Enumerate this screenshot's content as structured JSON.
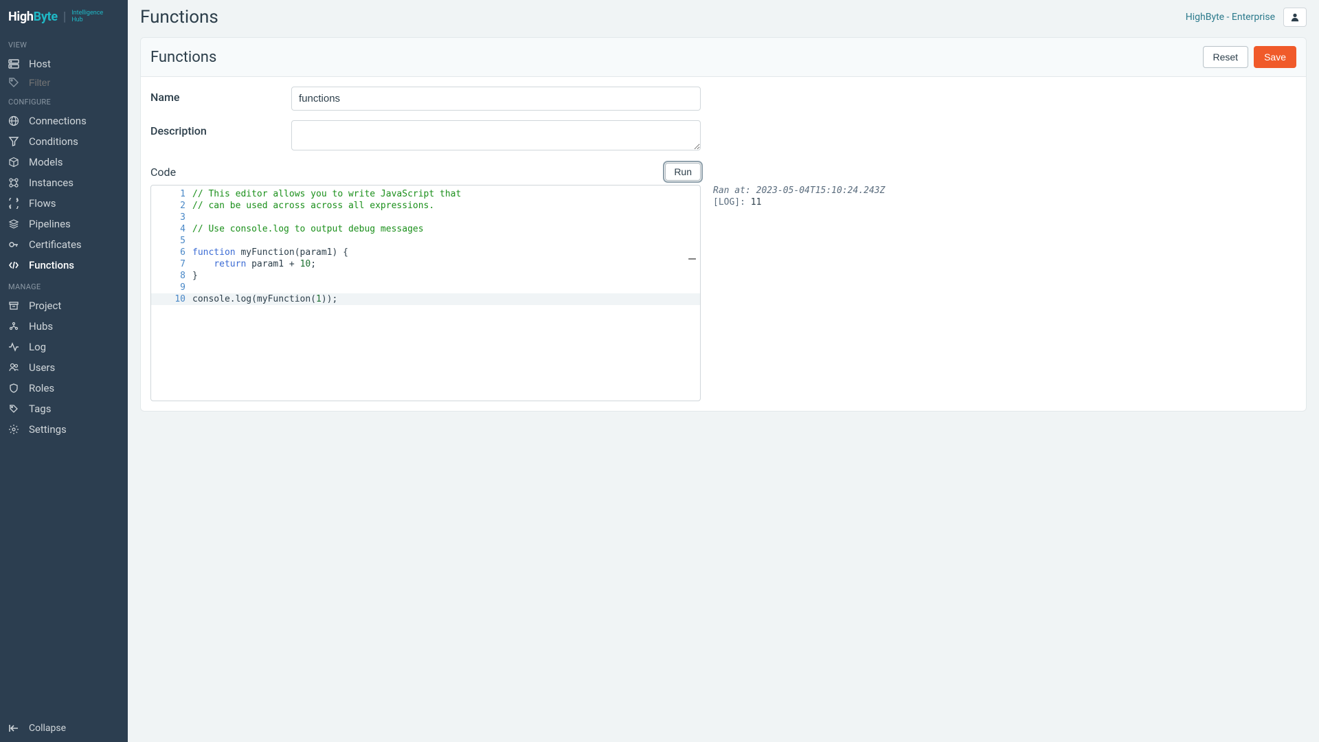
{
  "logo": {
    "brand": "HighByte",
    "sub1": "Intelligence",
    "sub2": "Hub"
  },
  "tenant": "HighByte - Enterprise",
  "page_title": "Functions",
  "sections": {
    "view": "VIEW",
    "configure": "CONFIGURE",
    "manage": "MANAGE"
  },
  "nav": {
    "host": "Host",
    "filter_placeholder": "Filter",
    "connections": "Connections",
    "conditions": "Conditions",
    "models": "Models",
    "instances": "Instances",
    "flows": "Flows",
    "pipelines": "Pipelines",
    "certificates": "Certificates",
    "functions": "Functions",
    "project": "Project",
    "hubs": "Hubs",
    "log": "Log",
    "users": "Users",
    "roles": "Roles",
    "tags": "Tags",
    "settings": "Settings",
    "collapse": "Collapse"
  },
  "card": {
    "title": "Functions",
    "reset": "Reset",
    "save": "Save"
  },
  "form": {
    "name_label": "Name",
    "name_value": "functions",
    "desc_label": "Description",
    "desc_value": "",
    "code_label": "Code",
    "run": "Run"
  },
  "code": {
    "l1": "// This editor allows you to write JavaScript that",
    "l2": "// can be used across across all expressions.",
    "l3": "",
    "l4": "// Use console.log to output debug messages",
    "l5": "",
    "l6_kw": "function",
    "l6_rest": " myFunction(param1) {",
    "l7_kw": "return",
    "l7_mid": " param1 + ",
    "l7_num": "10",
    "l7_end": ";",
    "l8": "}",
    "l9": "",
    "l10_a": "console.log(myFunction(",
    "l10_num": "1",
    "l10_b": "));",
    "line_nums": [
      "1",
      "2",
      "3",
      "4",
      "5",
      "6",
      "7",
      "8",
      "9",
      "10"
    ]
  },
  "output": {
    "ran_at": "Ran at: 2023-05-04T15:10:24.243Z",
    "log_prefix": "[LOG]: ",
    "log_value": "11"
  }
}
